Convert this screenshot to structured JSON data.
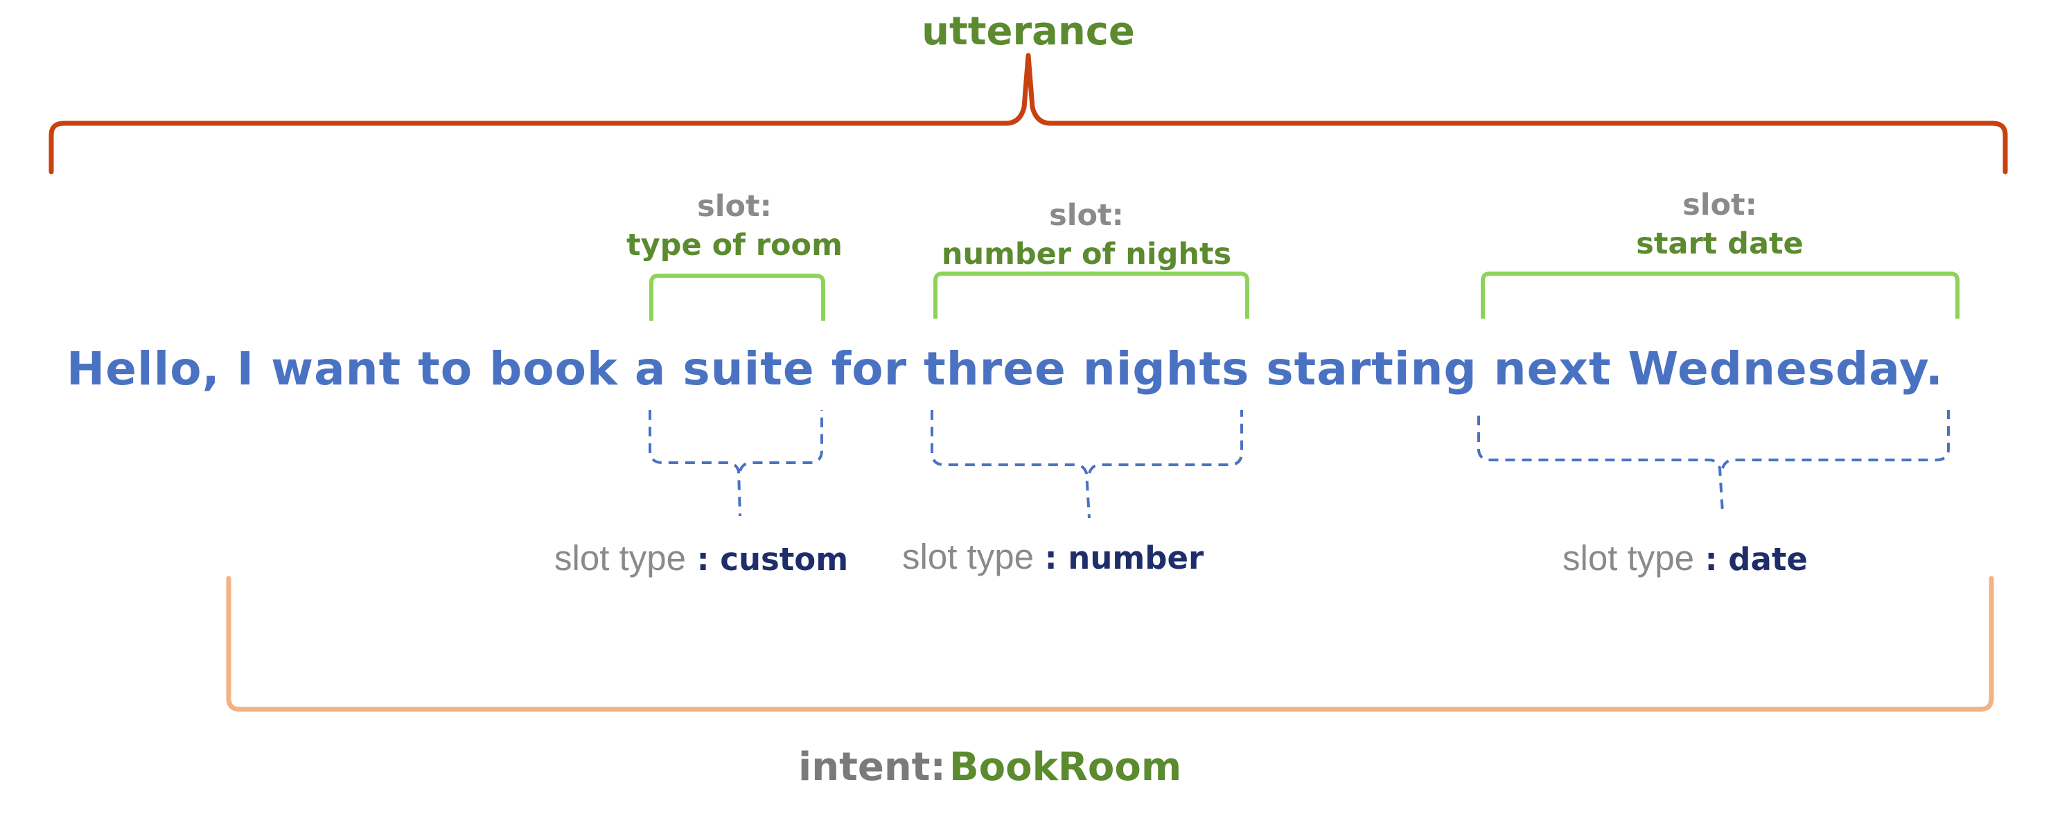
{
  "utterance_label": "utterance",
  "sentence": "Hello, I want to book a suite for three nights starting next Wednesday.",
  "slots": [
    {
      "keyword": "slot:",
      "name": "type of room",
      "type_keyword": "slot type",
      "type_value": "custom"
    },
    {
      "keyword": "slot:",
      "name": "number of nights",
      "type_keyword": "slot type",
      "type_value": "number"
    },
    {
      "keyword": "slot:",
      "name": "start date",
      "type_keyword": "slot type",
      "type_value": "date"
    }
  ],
  "intent": {
    "keyword": "intent:",
    "name": "BookRoom"
  },
  "colors": {
    "utterance_brace": "#c8410f",
    "intent_brace": "#f4b183",
    "slot_bracket": "#8dd35a",
    "slot_type_brace": "#4a72c2",
    "sentence": "#4a72c2",
    "green_label": "#5b8a2f"
  }
}
